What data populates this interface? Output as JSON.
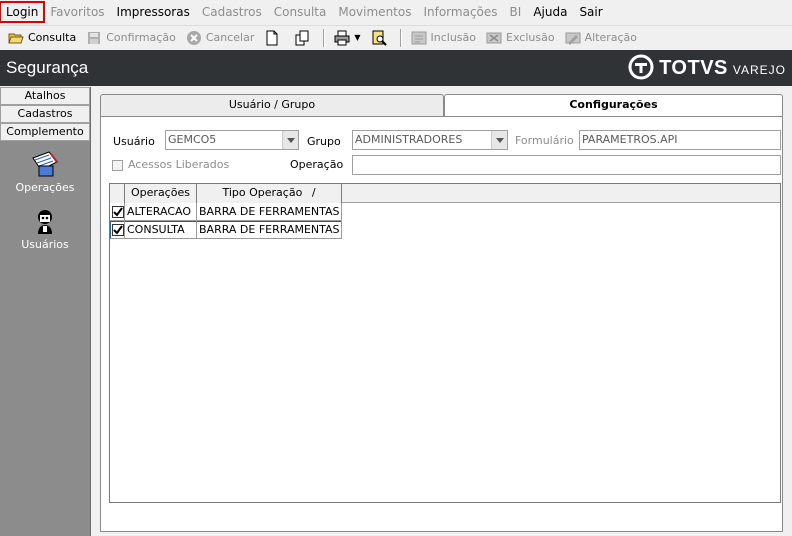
{
  "menu": {
    "items": [
      {
        "label": "Login",
        "enabled": true,
        "highlighted": true
      },
      {
        "label": "Favoritos",
        "enabled": false
      },
      {
        "label": "Impressoras",
        "enabled": true
      },
      {
        "label": "Cadastros",
        "enabled": false
      },
      {
        "label": "Consulta",
        "enabled": false
      },
      {
        "label": "Movimentos",
        "enabled": false
      },
      {
        "label": "Informações",
        "enabled": false
      },
      {
        "label": "BI",
        "enabled": false
      },
      {
        "label": "Ajuda",
        "enabled": true
      },
      {
        "label": "Sair",
        "enabled": true
      }
    ]
  },
  "toolbar": {
    "consulta": "Consulta",
    "confirmacao": "Confirmação",
    "cancelar": "Cancelar",
    "inclusao": "Inclusão",
    "exclusao": "Exclusão",
    "alteracao": "Alteração"
  },
  "header": {
    "title": "Segurança",
    "brand": "TOTVS",
    "brand_sub": "VAREJO"
  },
  "sidebar": {
    "tabs": [
      "Atalhos",
      "Cadastros",
      "Complemento"
    ],
    "items": [
      {
        "label": "Operações",
        "icon": "operations-icon"
      },
      {
        "label": "Usuários",
        "icon": "users-icon"
      }
    ]
  },
  "main": {
    "tabs": [
      {
        "label": "Usuário  / Grupo",
        "active": false
      },
      {
        "label": "Configurações",
        "active": true
      }
    ],
    "form": {
      "usuario_label": "Usuário",
      "usuario_value": "GEMCO5",
      "grupo_label": "Grupo",
      "grupo_value": "ADMINISTRADORES",
      "formulario_label": "Formulário",
      "formulario_value": "PARAMETROS.API",
      "acessos_label": "Acessos Liberados",
      "operacao_label": "Operação",
      "operacao_value": ""
    },
    "grid": {
      "columns": [
        "Operações",
        "Tipo Operação",
        "/"
      ],
      "rows": [
        {
          "checked": true,
          "operacao": "ALTERACAO",
          "tipo": "BARRA DE FERRAMENTAS"
        },
        {
          "checked": true,
          "operacao": "CONSULTA",
          "tipo": "BARRA DE FERRAMENTAS"
        }
      ]
    }
  },
  "colors": {
    "header_bg": "#2f3336",
    "sidebar_bg": "#8c8c8c",
    "highlight": "#e00000"
  }
}
